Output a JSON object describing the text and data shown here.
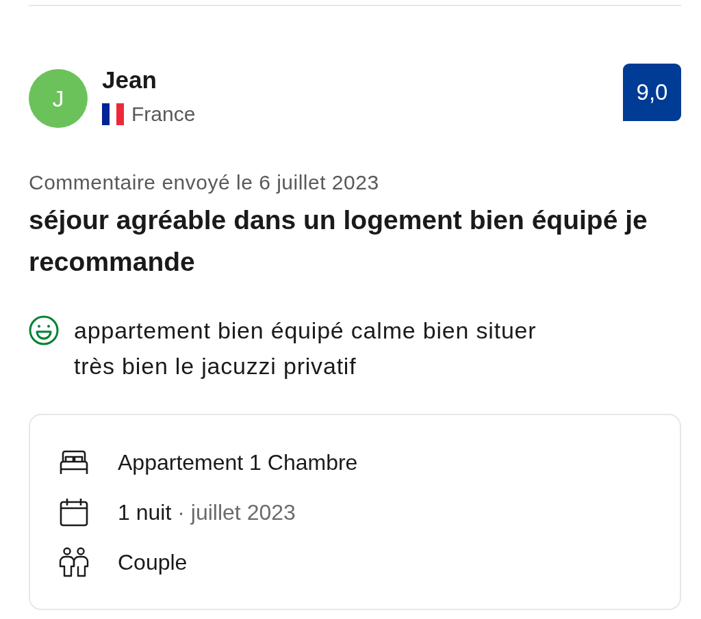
{
  "reviewer": {
    "initial": "J",
    "name": "Jean",
    "country": "France"
  },
  "score": "9,0",
  "review": {
    "date": "Commentaire envoyé le 6 juillet 2023",
    "title": "séjour agréable dans un logement bien équipé je recommande",
    "comments": [
      {
        "kind": "liked",
        "text": "appartement bien équipé calme bien situer\ntrès bien le jacuzzi privatif"
      }
    ]
  },
  "stay_details": [
    {
      "kind": "room",
      "text": "Appartement 1 Chambre"
    },
    {
      "kind": "stay",
      "text": "1 nuit",
      "detail": "· juillet 2023"
    },
    {
      "kind": "group",
      "text": "Couple"
    }
  ]
}
